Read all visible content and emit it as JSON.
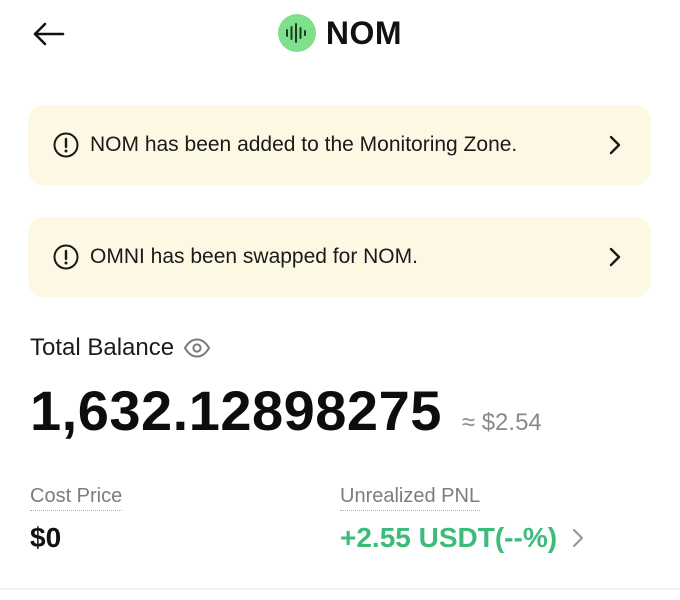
{
  "header": {
    "title": "NOM",
    "back_icon": "arrow-left-icon",
    "logo_icon": "nom-token-logo-icon"
  },
  "notices": [
    {
      "text": "NOM has been added to the Monitoring Zone.",
      "icon": "alert-circle-icon"
    },
    {
      "text": "OMNI has been swapped for NOM.",
      "icon": "alert-circle-icon"
    }
  ],
  "balance": {
    "label": "Total Balance",
    "value": "1,632.12898275",
    "fiat": "≈ $2.54",
    "eye_icon": "eye-icon"
  },
  "stats": {
    "cost_label": "Cost Price",
    "cost_value": "$0",
    "pnl_label": "Unrealized PNL",
    "pnl_value": "+2.55 USDT(--%)"
  },
  "colors": {
    "notice_bg": "#fdf8e4",
    "logo_bg": "#7ee08a",
    "pnl_green": "#3dbb7a"
  }
}
